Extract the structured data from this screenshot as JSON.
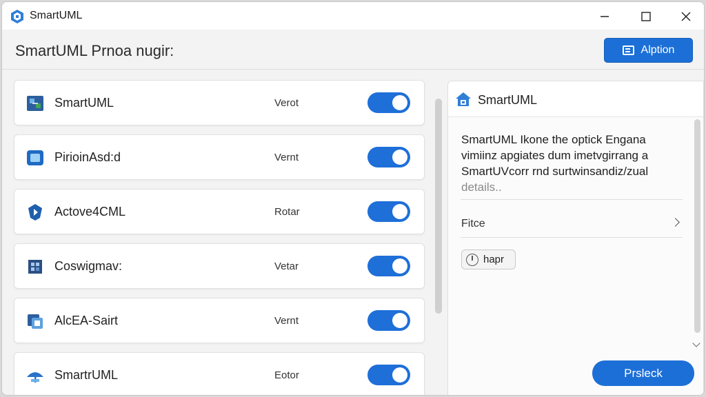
{
  "window": {
    "title": "SmartUML"
  },
  "header": {
    "title": "SmartUML Prnoa nugir:",
    "action_label": "Alption"
  },
  "plugins": [
    {
      "name": "SmartUML",
      "status": "Verot",
      "enabled": true,
      "icon": "uml-diagram-icon"
    },
    {
      "name": "PirioinAsd:d",
      "status": "Vernt",
      "enabled": true,
      "icon": "window-frame-icon"
    },
    {
      "name": "Actove4CML",
      "status": "Rotar",
      "enabled": true,
      "icon": "shield-arrow-icon"
    },
    {
      "name": "Coswigmav:",
      "status": "Vetar",
      "enabled": true,
      "icon": "grid-bracket-icon"
    },
    {
      "name": "AlcEA-Sairt",
      "status": "Vernt",
      "enabled": true,
      "icon": "stacked-squares-icon"
    },
    {
      "name": "SmartrUML",
      "status": "Eotor",
      "enabled": true,
      "icon": "umbrella-icon"
    }
  ],
  "details": {
    "title": "SmartUML",
    "description": [
      "SmartUML Ikone the optick Engana",
      "vimiinz apgiates dum imetvgirrang a",
      "SmartUVcorr rnd surtwinsandiz/zual",
      "details.."
    ],
    "field_label": "Fitce",
    "chip_label": "hapr",
    "primary_label": "Prsleck"
  },
  "colors": {
    "accent": "#1c6fd6",
    "toggle_on": "#1e6fd8"
  }
}
